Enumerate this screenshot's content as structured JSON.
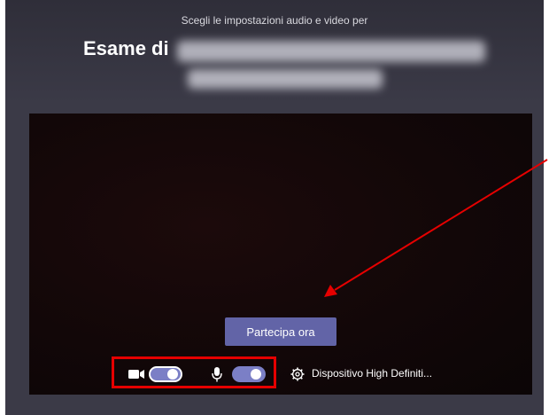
{
  "header": {
    "subtitle": "Scegli le impostazioni audio e video per",
    "title": "Esame di"
  },
  "preview": {
    "join_label": "Partecipa ora"
  },
  "controls": {
    "camera_on": true,
    "mic_on": true,
    "device_label": "Dispositivo High Definiti..."
  },
  "colors": {
    "accent": "#6264a7",
    "toggle_on": "#7b7fc6",
    "annotation": "#e60000",
    "background": "#3b3a47"
  },
  "icons": [
    "camera-icon",
    "microphone-icon",
    "gear-icon"
  ]
}
